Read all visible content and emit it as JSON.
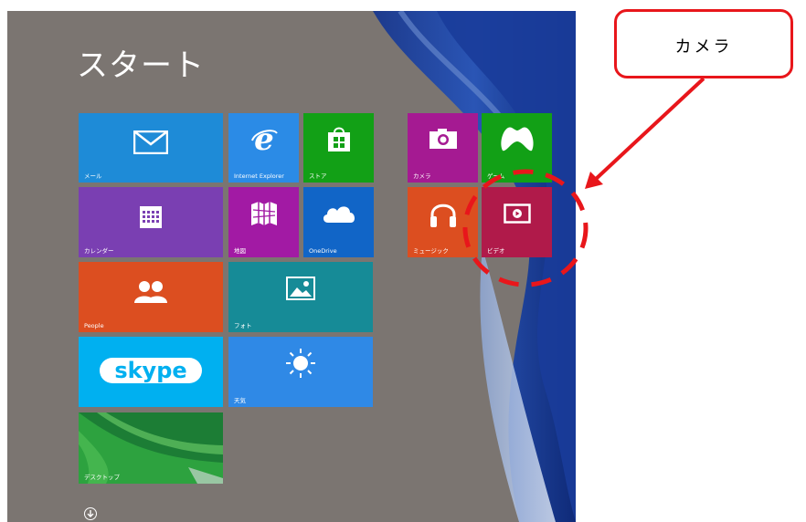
{
  "start_title": "スタート",
  "callout": {
    "text": "カメラ",
    "color": "#e8161b"
  },
  "tiles": {
    "mail": {
      "label": "メール",
      "color": "#1e8bd7",
      "icon": "envelope-icon"
    },
    "ie": {
      "label": "Internet Explorer",
      "color": "#2b8be6",
      "icon": "internet-explorer-icon"
    },
    "store": {
      "label": "ストア",
      "color": "#12a016",
      "icon": "store-bag-icon"
    },
    "calendar": {
      "label": "カレンダー",
      "color": "#7a3fb2",
      "icon": "calendar-icon"
    },
    "maps": {
      "label": "地図",
      "color": "#a21aa4",
      "icon": "map-icon"
    },
    "onedrive": {
      "label": "OneDrive",
      "color": "#1165c7",
      "icon": "cloud-icon"
    },
    "people": {
      "label": "People",
      "color": "#dc4e20",
      "icon": "people-icon"
    },
    "photos": {
      "label": "フォト",
      "color": "#168b97",
      "icon": "photo-icon"
    },
    "skype": {
      "label": "skype",
      "color": "#00b0f0",
      "icon": "skype-logo"
    },
    "weather": {
      "label": "天気",
      "color": "#2f89e6",
      "icon": "sun-icon"
    },
    "desktop": {
      "label": "デスクトップ",
      "color": "#1f8a3a",
      "icon": "desktop-wallpaper"
    },
    "camera": {
      "label": "カメラ",
      "color": "#a51a92",
      "icon": "camera-icon"
    },
    "games": {
      "label": "ゲーム",
      "color": "#12a016",
      "icon": "xbox-controller-icon"
    },
    "music": {
      "label": "ミュージック",
      "color": "#dc4e20",
      "icon": "headphones-icon"
    },
    "video": {
      "label": "ビデオ",
      "color": "#b01a4a",
      "icon": "video-play-icon"
    }
  },
  "all_apps_icon": "down-arrow-circle-icon"
}
